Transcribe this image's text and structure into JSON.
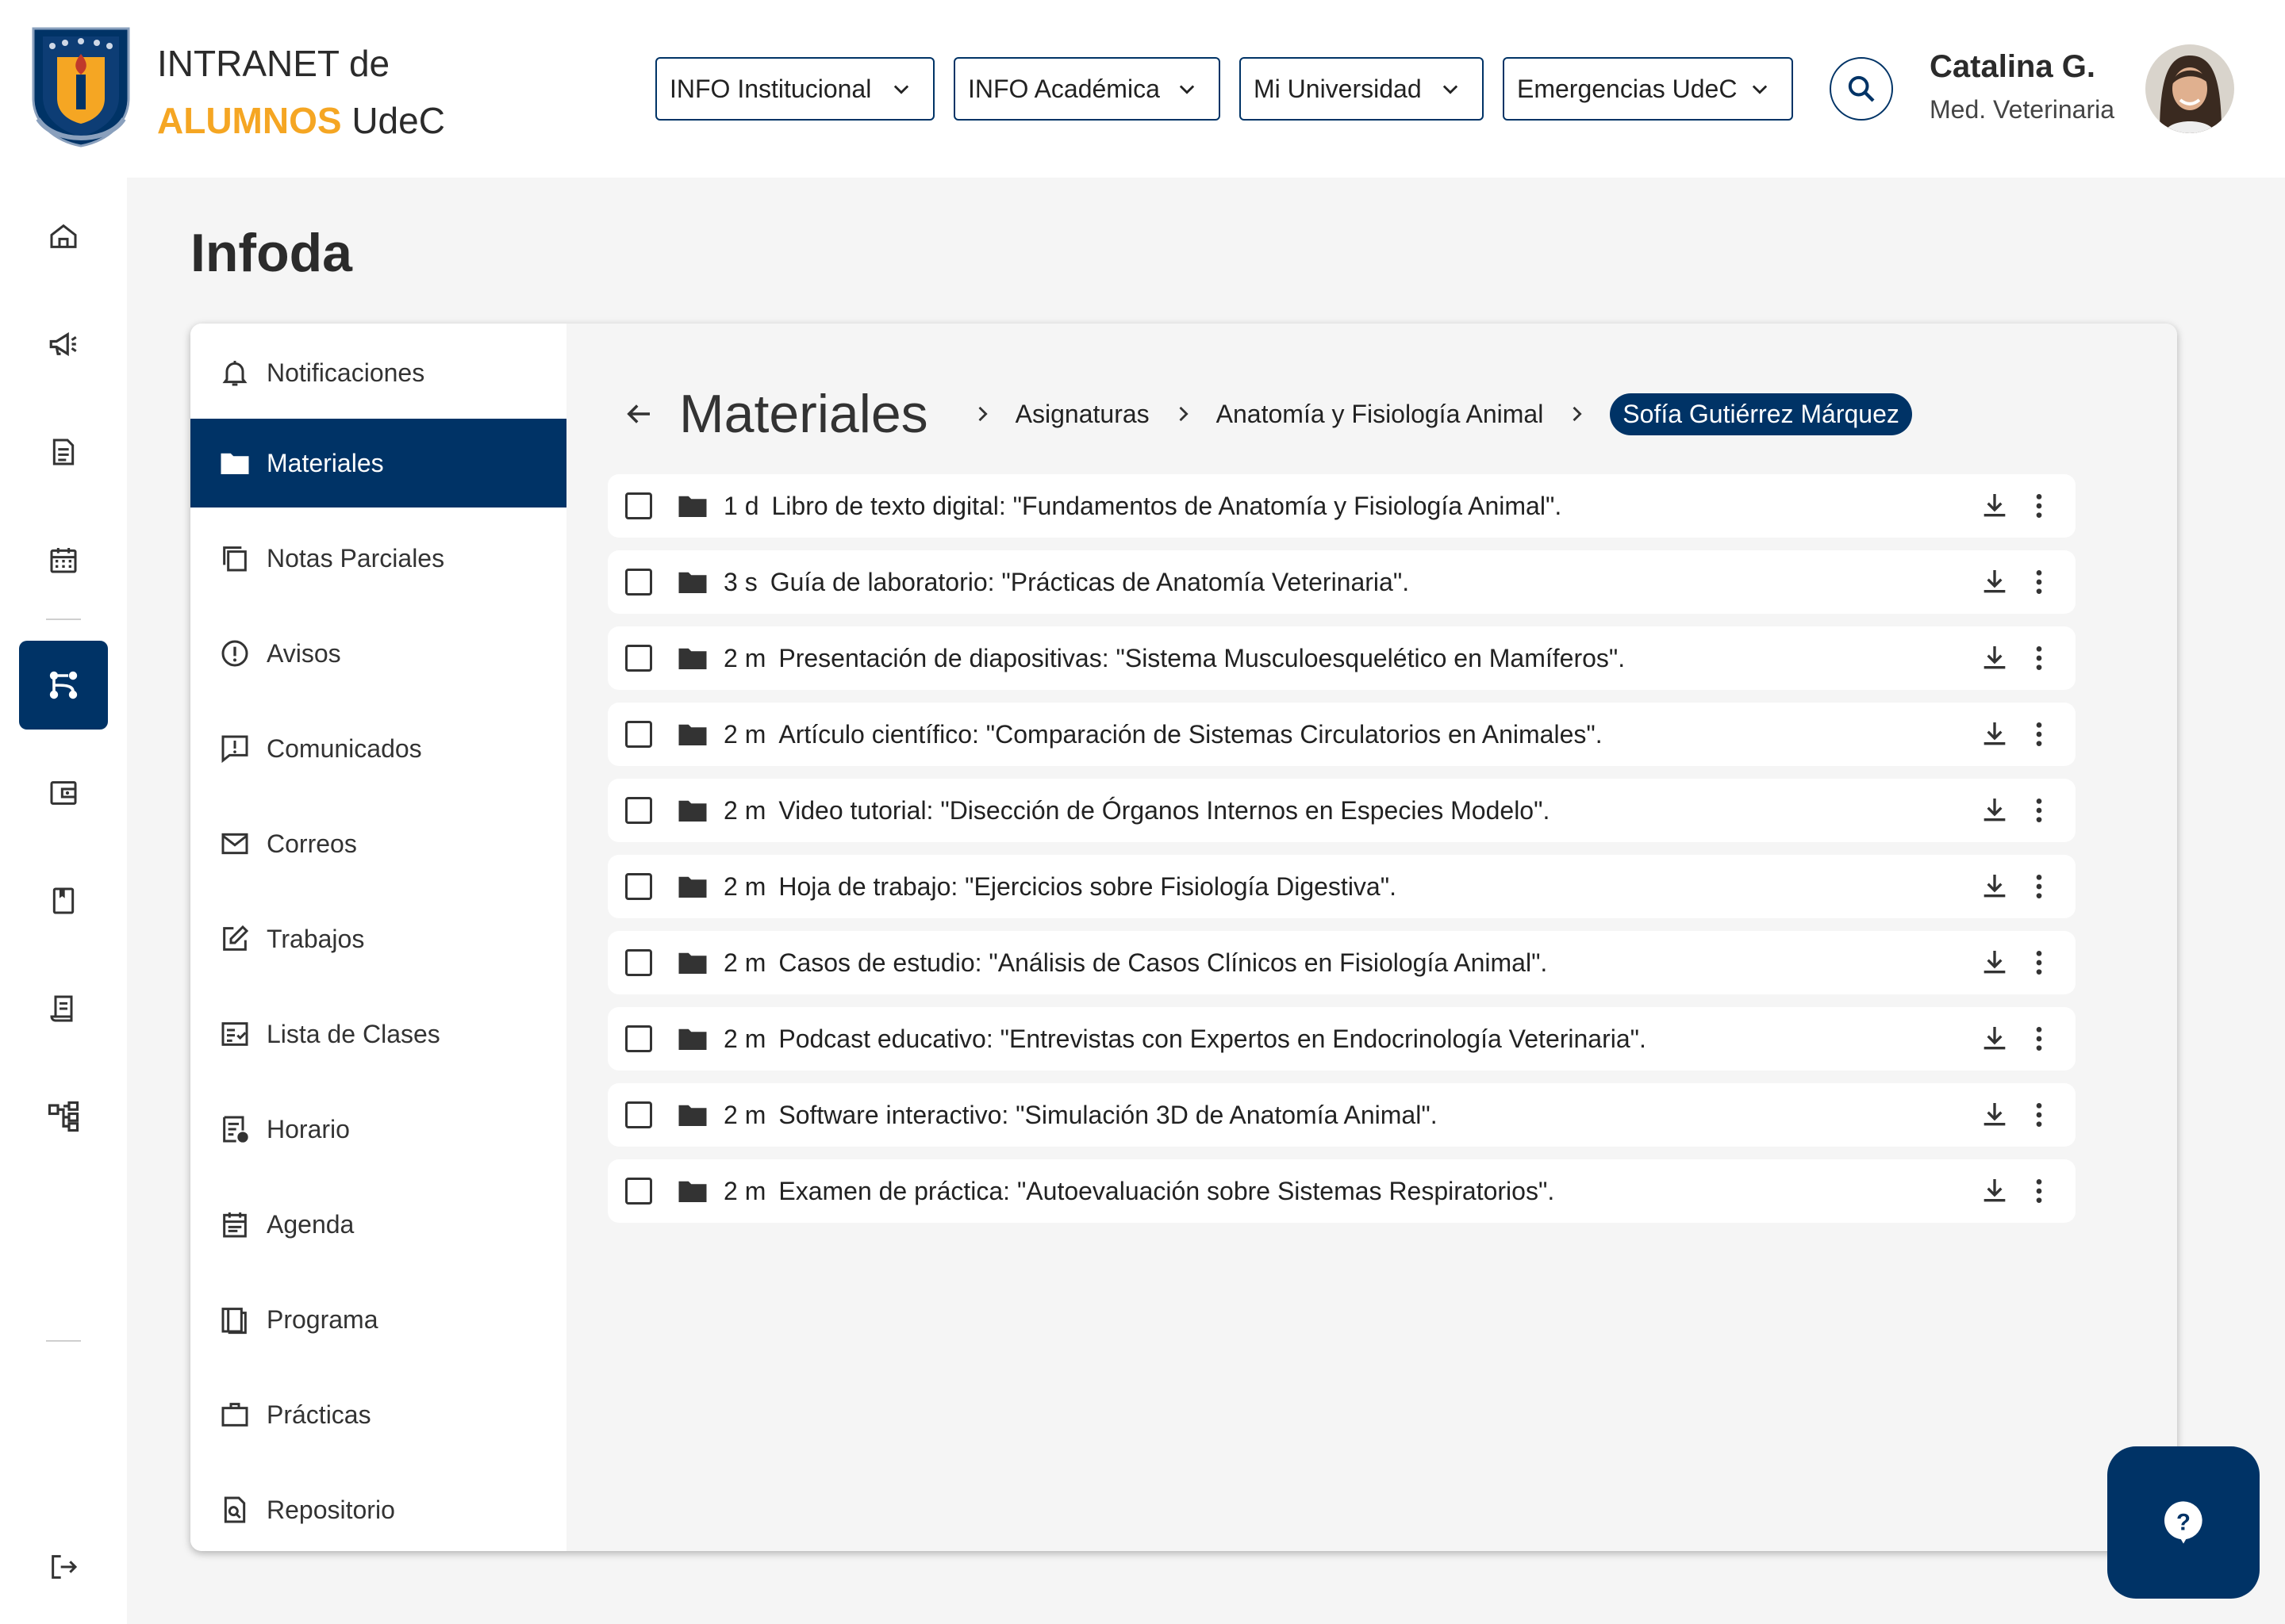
{
  "header": {
    "brand_line1": "INTRANET de",
    "brand_accent": "ALUMNOS",
    "brand_rest": "UdeC",
    "nav": [
      {
        "label": "INFO Institucional"
      },
      {
        "label": "INFO Académica"
      },
      {
        "label": "Mi Universidad"
      },
      {
        "label": "Emergencias UdeC"
      }
    ],
    "user": {
      "name": "Catalina G.",
      "career": "Med. Veterinaria"
    }
  },
  "rail": [
    {
      "icon": "home-icon"
    },
    {
      "icon": "megaphone-icon"
    },
    {
      "icon": "document-icon"
    },
    {
      "icon": "calendar-icon"
    },
    {
      "icon": "git-branch-icon",
      "active": true
    },
    {
      "icon": "wallet-icon"
    },
    {
      "icon": "book-icon"
    },
    {
      "icon": "receipt-icon"
    },
    {
      "icon": "hierarchy-icon"
    },
    {
      "icon": "logout-icon"
    }
  ],
  "page": {
    "title": "Infoda"
  },
  "submenu": [
    {
      "label": "Notificaciones",
      "icon": "bell-icon"
    },
    {
      "label": "Materiales",
      "icon": "folder-icon",
      "active": true
    },
    {
      "label": "Notas Parciales",
      "icon": "copy-icon"
    },
    {
      "label": "Avisos",
      "icon": "alert-circle-icon"
    },
    {
      "label": "Comunicados",
      "icon": "message-alert-icon"
    },
    {
      "label": "Correos",
      "icon": "mail-icon"
    },
    {
      "label": "Trabajos",
      "icon": "edit-icon"
    },
    {
      "label": "Lista de Clases",
      "icon": "checklist-icon"
    },
    {
      "label": "Horario",
      "icon": "schedule-icon"
    },
    {
      "label": "Agenda",
      "icon": "agenda-icon"
    },
    {
      "label": "Programa",
      "icon": "book-open-icon"
    },
    {
      "label": "Prácticas",
      "icon": "briefcase-icon"
    },
    {
      "label": "Repositorio",
      "icon": "file-search-icon"
    }
  ],
  "breadcrumb": {
    "title": "Materiales",
    "items": [
      "Asignaturas",
      "Anatomía y Fisiología Animal"
    ],
    "current": "Sofía Gutiérrez Márquez"
  },
  "materials": [
    {
      "age": "1 d",
      "title": "Libro de texto digital: \"Fundamentos de Anatomía y Fisiología Animal\"."
    },
    {
      "age": "3 s",
      "title": "Guía de laboratorio: \"Prácticas de Anatomía Veterinaria\"."
    },
    {
      "age": "2 m",
      "title": "Presentación de diapositivas: \"Sistema Musculoesquelético en Mamíferos\"."
    },
    {
      "age": "2 m",
      "title": "Artículo científico: \"Comparación de Sistemas Circulatorios en Animales\"."
    },
    {
      "age": "2 m",
      "title": "Video tutorial: \"Disección de Órganos Internos en Especies Modelo\"."
    },
    {
      "age": "2 m",
      "title": "Hoja de trabajo: \"Ejercicios sobre Fisiología Digestiva\"."
    },
    {
      "age": "2 m",
      "title": "Casos de estudio: \"Análisis de Casos Clínicos en Fisiología Animal\"."
    },
    {
      "age": "2 m",
      "title": "Podcast educativo: \"Entrevistas con Expertos en Endocrinología Veterinaria\"."
    },
    {
      "age": "2 m",
      "title": "Software interactivo: \"Simulación 3D de Anatomía Animal\"."
    },
    {
      "age": "2 m",
      "title": "Examen de práctica: \"Autoevaluación sobre Sistemas Respiratorios\"."
    }
  ],
  "colors": {
    "primary": "#003366",
    "accent": "#f5a623",
    "background": "#f5f5f5"
  }
}
